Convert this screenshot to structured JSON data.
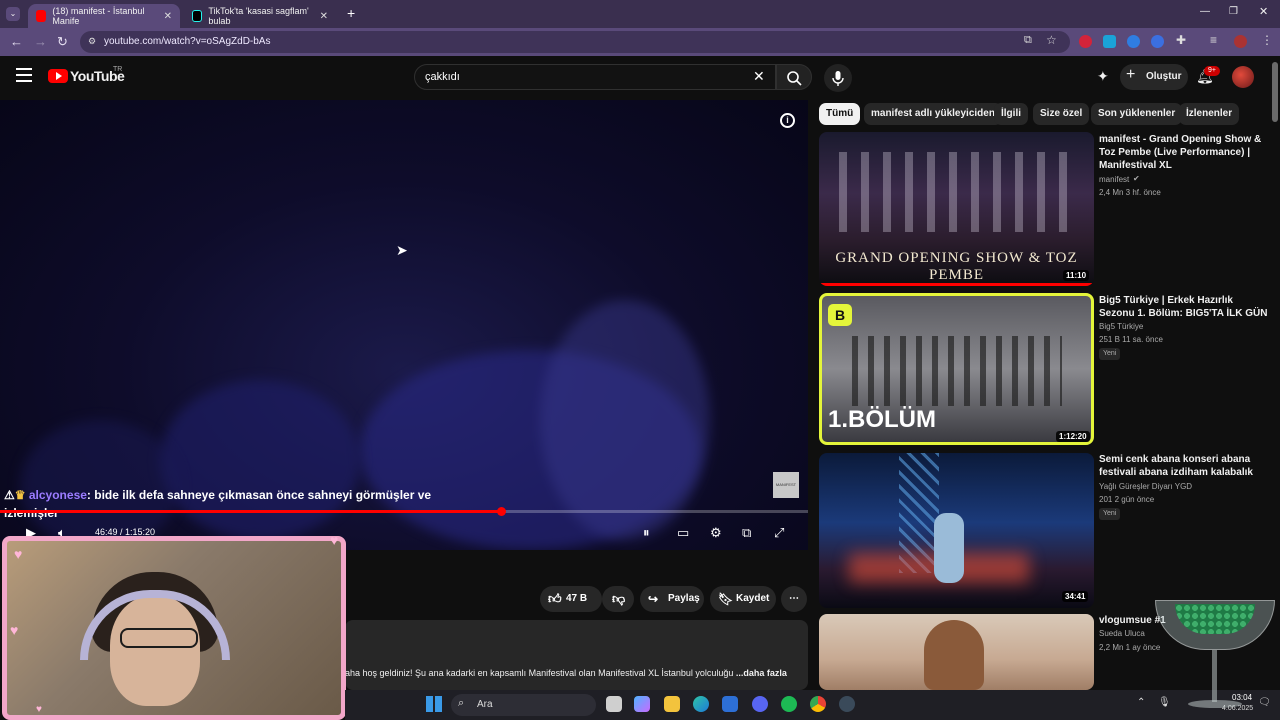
{
  "browser": {
    "tabs": [
      {
        "label": "(18) manifest - İstanbul Manife",
        "active": true
      },
      {
        "label": "TikTok'ta 'kasasi sagflam' bulab",
        "active": false
      }
    ],
    "new_tab_glyph": "+",
    "url": "youtube.com/watch?v=oSAgZdD-bAs"
  },
  "youtube": {
    "logo_text": "YouTube",
    "logo_region": "TR",
    "search_query": "çakkıdı",
    "create_label": "Oluştur",
    "notification_count": "9+"
  },
  "player": {
    "chat_user": "alcyonese",
    "chat_message": ": bide ilk defa sahneye çıkmasan önce sahneyi görmüşler ve izlemişler",
    "watermark_text": "MANIFEST",
    "time": "46:49 / 1:15:20",
    "progress_fraction": 0.62
  },
  "actions": {
    "like_count": "47 B",
    "share_label": "Paylaş",
    "save_label": "Kaydet"
  },
  "description": {
    "text": "aha hoş geldiniz! Şu ana kadarki en kapsamlı Manifestival olan Manifestival XL İstanbul yolculuğu",
    "more": "...daha fazla"
  },
  "chips": [
    "Tümü",
    "manifest adlı yükleyiciden",
    "İlgili",
    "Size özel",
    "Son yüklenenler",
    "İzlenenler"
  ],
  "recommendations": [
    {
      "title": "manifest - Grand Opening Show & Toz Pembe (Live Performance) | Manifestival XL",
      "channel": "manifest",
      "meta": "2,4 Mn  3 hf. önce",
      "duration": "11:10",
      "thumb_caption": "GRAND OPENING SHOW & TOZ PEMBE",
      "new_badge": ""
    },
    {
      "title": "Big5 Türkiye | Erkek Hazırlık Sezonu 1. Bölüm: BIG5'TA İLK GÜN",
      "channel": "Big5 Türkiye",
      "meta": "251 B  11 sa. önce",
      "duration": "1:12:20",
      "thumb_caption": "1.BÖLÜM",
      "new_badge": "Yeni"
    },
    {
      "title": "Semi cenk abana konseri abana festivali  abana izdiham kalabalık",
      "channel": "Yağlı Güreşler Diyarı YGD",
      "meta": "201  2 gün önce",
      "duration": "34:41",
      "thumb_caption": "",
      "new_badge": "Yeni"
    },
    {
      "title": "vlogumsue #1",
      "channel": "Sueda Uluca",
      "meta": "2,2 Mn  1 ay önce",
      "duration": "",
      "thumb_caption": "",
      "new_badge": ""
    }
  ],
  "taskbar": {
    "search_placeholder": "Ara",
    "clock_time": "03:04",
    "clock_date": "4.06.2025"
  },
  "colors": {
    "accent_red": "#ff0000",
    "browser_frame": "#5a4a7a",
    "webcam_border": "#f2a7c9"
  }
}
